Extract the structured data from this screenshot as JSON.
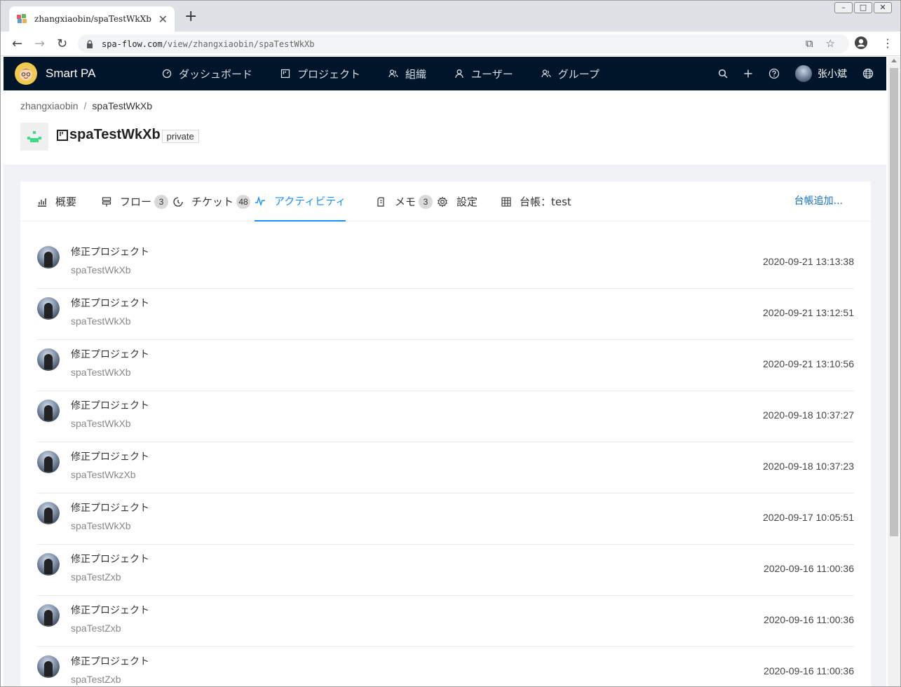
{
  "browser": {
    "tab_title": "zhangxiaobin/spaTestWkXb",
    "url_host": "spa-flow.com",
    "url_path": "/view/zhangxiaobin/spaTestWkXb"
  },
  "app": {
    "name": "Smart PA",
    "nav": [
      {
        "label": "ダッシュボード",
        "icon": "dashboard-icon"
      },
      {
        "label": "プロジェクト",
        "icon": "project-icon"
      },
      {
        "label": "組織",
        "icon": "organization-icon"
      },
      {
        "label": "ユーザー",
        "icon": "user-icon"
      },
      {
        "label": "グループ",
        "icon": "group-icon"
      }
    ],
    "user_name": "张小斌"
  },
  "breadcrumb": {
    "owner": "zhangxiaobin",
    "separator": "/",
    "project": "spaTestWkXb"
  },
  "project": {
    "name": "spaTestWkXb",
    "visibility": "private"
  },
  "tabs": [
    {
      "label": "概要",
      "count": null
    },
    {
      "label": "フロー",
      "count": "3"
    },
    {
      "label": "チケット",
      "count": "48"
    },
    {
      "label": "アクティビティ",
      "count": null,
      "active": true
    },
    {
      "label": "メモ",
      "count": "3"
    },
    {
      "label": "設定",
      "count": null
    },
    {
      "label": "台帳：test",
      "count": null
    }
  ],
  "add_ledger_label": "台帳追加...",
  "activities": [
    {
      "title": "修正プロジェクト",
      "project": "spaTestWkXb",
      "time": "2020-09-21 13:13:38"
    },
    {
      "title": "修正プロジェクト",
      "project": "spaTestWkXb",
      "time": "2020-09-21 13:12:51"
    },
    {
      "title": "修正プロジェクト",
      "project": "spaTestWkXb",
      "time": "2020-09-21 13:10:56"
    },
    {
      "title": "修正プロジェクト",
      "project": "spaTestWkXb",
      "time": "2020-09-18 10:37:27"
    },
    {
      "title": "修正プロジェクト",
      "project": "spaTestWkzXb",
      "time": "2020-09-18 10:37:23"
    },
    {
      "title": "修正プロジェクト",
      "project": "spaTestWkXb",
      "time": "2020-09-17 10:05:51"
    },
    {
      "title": "修正プロジェクト",
      "project": "spaTestZxb",
      "time": "2020-09-16 11:00:36"
    },
    {
      "title": "修正プロジェクト",
      "project": "spaTestZxb",
      "time": "2020-09-16 11:00:36"
    },
    {
      "title": "修正プロジェクト",
      "project": "spaTestZxb",
      "time": "2020-09-16 11:00:36"
    }
  ],
  "colors": {
    "header_bg": "#001529",
    "accent": "#1890ff",
    "page_bg": "#f0f2f5"
  }
}
